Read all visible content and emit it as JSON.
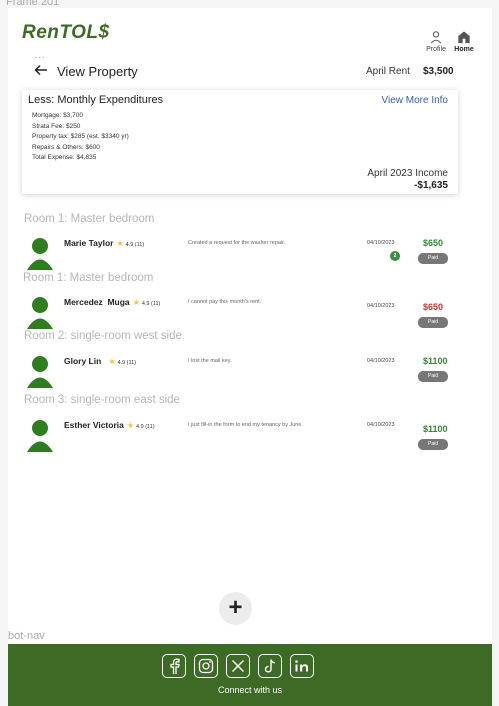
{
  "frame_label": "Frame 201",
  "brand": {
    "logo": "RenTOL$"
  },
  "nav": {
    "profile": "Profile",
    "home": "Home"
  },
  "header": {
    "dots": "...",
    "back_icon": "arrow-left",
    "title": "View Property",
    "rent_label": "April Rent",
    "rent_value": "$3,500"
  },
  "expenditures": {
    "title": "Less: Monthly Expenditures",
    "link": "View More Info",
    "items": [
      "Mortgage: $3,700",
      "Strata Fee: $250",
      "Property tax: $285 (est. $3340 yr)",
      "Repairs & Others: $600",
      "Total Expense: $4,835"
    ],
    "income_label": "April 2023 Income",
    "income_value": "-$1,635"
  },
  "rooms": [
    {
      "heading": "Room 1:  Master bedroom",
      "tenant": {
        "name": "Marie Taylor",
        "star": "★",
        "rating": "4.9 (11)",
        "message": "Created a request for the washer repair.",
        "date": "04/10/2023",
        "badge": "2",
        "amount": "$650",
        "amount_color": "#2e8b2e",
        "status": "Paid"
      }
    },
    {
      "heading": "Room 1: Master bedroom",
      "tenant": {
        "name": "Mercedez  Muga",
        "star": "★",
        "rating": "4.9 (11)",
        "message": "I cannot pay this month's rent.",
        "date": "04/10/2023",
        "badge": "",
        "amount": "$650",
        "amount_color": "#d32f2f",
        "status": "Paid"
      }
    },
    {
      "heading": "Room 2: single-room west side",
      "tenant": {
        "name": "Glory Lin",
        "star": "★",
        "rating": "4.9 (11)",
        "message": "I lost the mail key.",
        "date": "04/10/2023",
        "badge": "",
        "amount": "$1100",
        "amount_color": "#2e8b2e",
        "status": "Paid"
      }
    },
    {
      "heading": "Room 3: single-room east side",
      "tenant": {
        "name": "Esther Victoria",
        "star": "★",
        "rating": "4.9 (11)",
        "message": "I just fill-in the form to end my tenancy by June.",
        "date": "04/10/2023",
        "badge": "",
        "amount": "$1100",
        "amount_color": "#2e8b2e",
        "status": "Paid"
      }
    }
  ],
  "add_button": "+",
  "botnav_label": "bot-nav",
  "footer": {
    "connect": "Connect with us",
    "icons": [
      "facebook-icon",
      "instagram-icon",
      "x-icon",
      "tiktok-icon",
      "linkedin-icon"
    ]
  },
  "colors": {
    "brand_green": "#3d6b25",
    "avatar_green": "#2e7d1f",
    "link_blue": "#3a5fa8",
    "paid_gray": "#777777"
  }
}
